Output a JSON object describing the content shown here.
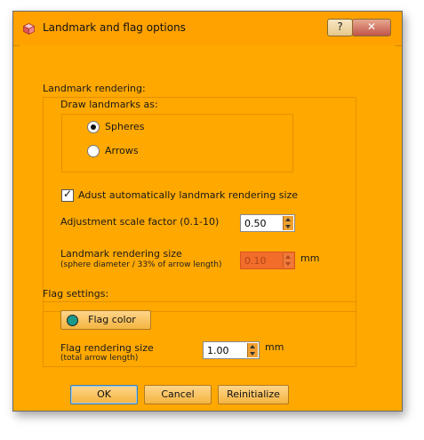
{
  "window": {
    "title": "Landmark and flag options",
    "help_label": "?",
    "close_label": "✕"
  },
  "landmark": {
    "group_title": "Landmark rendering:",
    "draw_title": "Draw landmarks as:",
    "options": [
      {
        "label": "Spheres",
        "selected": true
      },
      {
        "label": "Arrows",
        "selected": false
      }
    ],
    "auto_adjust_label": "Adust automatically landmark rendering size",
    "auto_adjust_checked": true,
    "scale_label": "Adjustment scale factor (0.1-10)",
    "scale_value": "0.50",
    "size_label": "Landmark rendering size",
    "size_sublabel": "(sphere diameter / 33% of arrow length)",
    "size_value": "0.10",
    "size_unit": "mm"
  },
  "flag": {
    "group_title": "Flag settings:",
    "color_button_label": "Flag color",
    "color": "#1a9a8a",
    "size_label": "Flag rendering size",
    "size_sublabel": "(total arrow length)",
    "size_value": "1.00",
    "size_unit": "mm"
  },
  "buttons": {
    "ok": "OK",
    "cancel": "Cancel",
    "reinitialize": "Reinitialize"
  }
}
